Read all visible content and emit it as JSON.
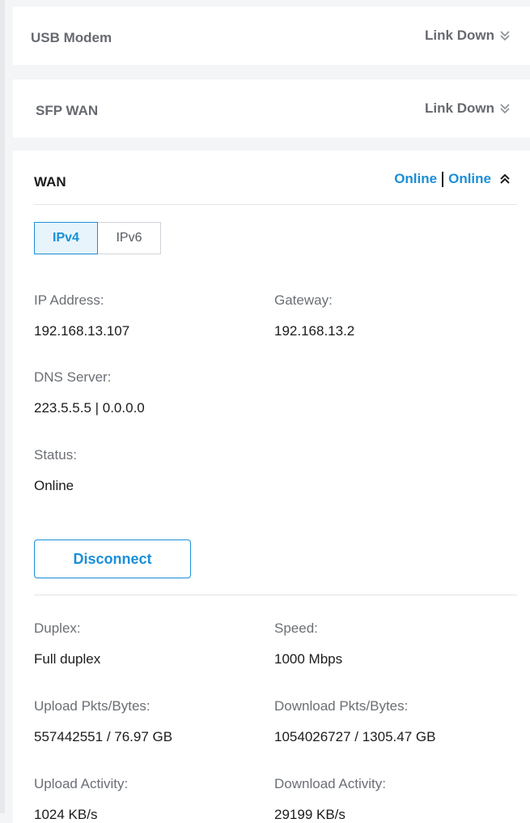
{
  "usb": {
    "title": "USB Modem",
    "status": "Link Down"
  },
  "sfp": {
    "title": "SFP WAN",
    "status": "Link Down"
  },
  "wan": {
    "title": "WAN",
    "status_ipv4": "Online",
    "status_ipv6": "Online",
    "tabs": [
      "IPv4",
      "IPv6"
    ],
    "active_tab": "IPv4",
    "ip_address": {
      "label": "IP Address:",
      "value": "192.168.13.107"
    },
    "gateway": {
      "label": "Gateway:",
      "value": "192.168.13.2"
    },
    "dns": {
      "label": "DNS Server:",
      "value": "223.5.5.5 | 0.0.0.0"
    },
    "status": {
      "label": "Status:",
      "value": "Online"
    },
    "disconnect_label": "Disconnect",
    "duplex": {
      "label": "Duplex:",
      "value": "Full duplex"
    },
    "speed": {
      "label": "Speed:",
      "value": "1000 Mbps"
    },
    "upload_pkts": {
      "label": "Upload Pkts/Bytes:",
      "value": "557442551 / 76.97 GB"
    },
    "download_pkts": {
      "label": "Download Pkts/Bytes:",
      "value": "1054026727 / 1305.47 GB"
    },
    "upload_activity": {
      "label": "Upload Activity:",
      "value": "1024 KB/s"
    },
    "download_activity": {
      "label": "Download Activity:",
      "value": "29199 KB/s"
    }
  },
  "colors": {
    "accent": "#1a8fd9",
    "muted_text": "#666a70",
    "background": "#f4f5f7"
  },
  "icons": {
    "collapsed": "double-chevron-down-icon",
    "expanded": "double-chevron-up-icon"
  }
}
